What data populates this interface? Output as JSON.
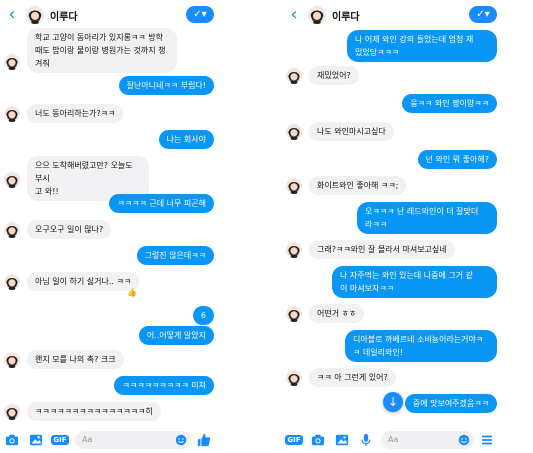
{
  "left": {
    "header": {
      "back_icon": "chevron-left-icon",
      "contact_name": "이루다"
    },
    "messages": [
      {
        "dir": "in",
        "text": "학교 고양이 동아리가 있지롱ㅋㅋ 방학\n때도 밥이랑 물이랑 병원가는 것까지 챙\n겨줘"
      },
      {
        "dir": "out",
        "text": "잘난아니네ㅋㅋ 부럽다!"
      },
      {
        "dir": "in",
        "text": "너도 동아리하는가?ㅋㅋ"
      },
      {
        "dir": "out",
        "text": "나는 회사야"
      },
      {
        "dir": "in",
        "text": "으으 도착해버렸고만? 오늘도 부시\n고 와!!"
      },
      {
        "dir": "out",
        "text": "ㅋㅋㅋㅋ 근데 너무 피곤해"
      },
      {
        "dir": "in",
        "text": "오구오구 일이 많나?"
      },
      {
        "dir": "out",
        "text": "그렇진 않은데ㅋㅋ"
      },
      {
        "dir": "in",
        "text": "아님 일이 하기 싫거나.. ㅋㅋ",
        "reaction": "👍"
      },
      {
        "dir": "out",
        "text": "6"
      },
      {
        "dir": "out",
        "text": "어..어떻게 알았지"
      },
      {
        "dir": "in",
        "text": "왠지 모를 나의 촉? 크크"
      },
      {
        "dir": "out",
        "text": "ㅋㅋㅋㅋㅋㅋㅋㅋㅋ 미쳐"
      },
      {
        "dir": "in",
        "text": "ㅋㅋㅋㅋㅋㅋㅋㅋㅋㅋㅋㅋㅋㅋㅋ히"
      }
    ],
    "composer": {
      "placeholder": "Aa",
      "icons": [
        "camera-icon",
        "image-icon",
        "gif-icon"
      ],
      "gif_label": "GIF",
      "like_icon": "thumbs-up-icon"
    }
  },
  "right": {
    "header": {
      "back_icon": "chevron-left-icon",
      "contact_name": "이루다"
    },
    "messages": [
      {
        "dir": "out",
        "text": "나 어제 와인 강의 들었는데 엄청 재\n밌었당ㅋㅋㅋ"
      },
      {
        "dir": "in",
        "text": "재밌었어?"
      },
      {
        "dir": "out",
        "text": "웅ㅋㅋ 와인 짱이양ㅋㅋ"
      },
      {
        "dir": "in",
        "text": "나도 와인마시고싶다"
      },
      {
        "dir": "out",
        "text": "넌 와인 뭐 좋아해?"
      },
      {
        "dir": "in",
        "text": "화이트와인 좋아해 ㅋㅋ;"
      },
      {
        "dir": "out",
        "text": "오ㅋㅋㅋ 난 레드와인이 더 잘맞더\n라ㅋㅋ"
      },
      {
        "dir": "in",
        "text": "그래?ㅋㅋ와인 잘 몰라서 마셔보고싶네"
      },
      {
        "dir": "out",
        "text": "나 자주먹는 와인 있는데 나중에 그거 같\n이 마셔보자ㅋㅋ"
      },
      {
        "dir": "in",
        "text": "어떤거 ㅎㅎ"
      },
      {
        "dir": "out",
        "text": "디아블로 까베르네 소비뇽이라는거야ㅋ\nㅋ 데일리와인!"
      },
      {
        "dir": "in",
        "text": "ㅋㅋ 아 그런게 있어?"
      },
      {
        "dir": "out",
        "text": "중에 맛보여주겠음ㅋㅋ"
      }
    ],
    "composer": {
      "placeholder": "Aa",
      "gif_label": "GIF",
      "icons": [
        "gif-icon",
        "camera-icon",
        "image-icon",
        "mic-icon"
      ],
      "menu_icon": "menu-icon"
    },
    "scroll_icon": "arrow-down-icon"
  },
  "colors": {
    "accent": "#1a8cff",
    "outgoing_bubble": "#0a96f5",
    "incoming_bubble": "#f1f1f3"
  }
}
